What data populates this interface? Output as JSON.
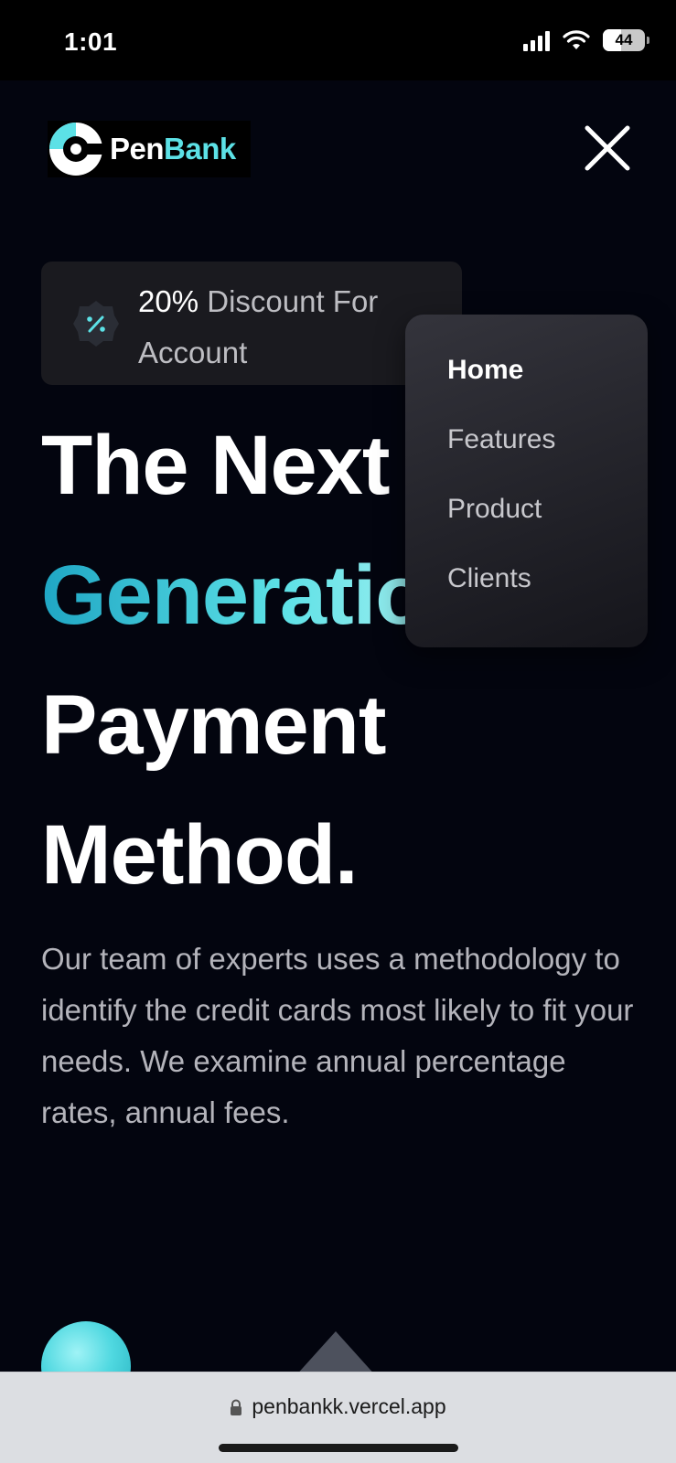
{
  "status_bar": {
    "time": "1:01",
    "battery": "44"
  },
  "brand": {
    "part1": "Pen",
    "part2": "Bank",
    "accent_color": "#5ce1e6"
  },
  "promo": {
    "highlight": "20%",
    "text": "Discount For",
    "text_line2": "Account",
    "icon": "percent-badge-icon"
  },
  "hero": {
    "line1": "The Next",
    "line2": "Generation",
    "line3": "Payment",
    "line4": "Method."
  },
  "description": "Our team of experts uses a methodology to identify the credit cards most likely to fit your needs. We examine annual percentage rates, annual fees.",
  "menu": {
    "items": [
      {
        "label": "Home",
        "active": true
      },
      {
        "label": "Features"
      },
      {
        "label": "Product"
      },
      {
        "label": "Clients"
      }
    ]
  },
  "browser": {
    "url": "penbankk.vercel.app"
  },
  "icons": {
    "close": "close-icon",
    "lock": "lock-icon",
    "wifi": "wifi-icon",
    "signal": "signal-icon",
    "logo": "logo-mark-icon"
  }
}
